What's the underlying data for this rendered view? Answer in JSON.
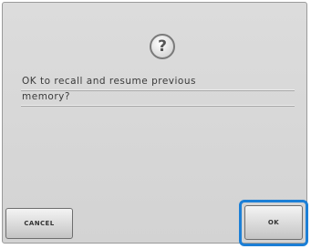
{
  "dialog": {
    "icon": "question-icon",
    "icon_glyph": "?",
    "message_lines": [
      "OK to recall and resume previous",
      "memory?"
    ]
  },
  "buttons": {
    "cancel_label": "CANCEL",
    "ok_label": "OK"
  },
  "colors": {
    "screen_background": "#d8d8d8",
    "highlight_border": "#1c7fd6"
  }
}
